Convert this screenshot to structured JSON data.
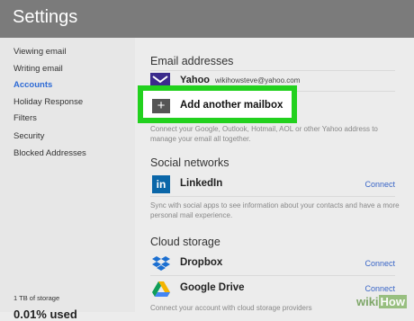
{
  "header": {
    "title": "Settings"
  },
  "sidebar": {
    "items": [
      {
        "label": "Viewing email",
        "active": false
      },
      {
        "label": "Writing email",
        "active": false
      },
      {
        "label": "Accounts",
        "active": true
      },
      {
        "label": "Holiday Response",
        "active": false
      },
      {
        "label": "Filters",
        "active": false
      },
      {
        "label": "Security",
        "active": false
      },
      {
        "label": "Blocked Addresses",
        "active": false
      }
    ],
    "storage_label": "1 TB of storage",
    "usage_text": "0.01% used"
  },
  "email_section": {
    "title": "Email addresses",
    "account_name": "Yahoo",
    "account_email": "wikihowsteve@yahoo.com",
    "add_label": "Add another mailbox",
    "description": "Connect your Google, Outlook, Hotmail, AOL or other Yahoo address to manage your email all together."
  },
  "social_section": {
    "title": "Social networks",
    "service_name": "LinkedIn",
    "connect_label": "Connect",
    "description": "Sync with social apps to see information about your contacts and have a more personal mail experience."
  },
  "cloud_section": {
    "title": "Cloud storage",
    "services": [
      {
        "name": "Dropbox",
        "connect_label": "Connect"
      },
      {
        "name": "Google Drive",
        "connect_label": "Connect"
      }
    ],
    "description": "Connect your account with cloud storage providers"
  },
  "watermark": {
    "wiki": "wiki",
    "how": "How"
  },
  "colors": {
    "header_bg": "#7b7b7b",
    "accent_link": "#2e6bd6",
    "highlight_border": "#22d11e",
    "yahoo_purple": "#3b2b8c",
    "linkedin_blue": "#0a66a8"
  }
}
